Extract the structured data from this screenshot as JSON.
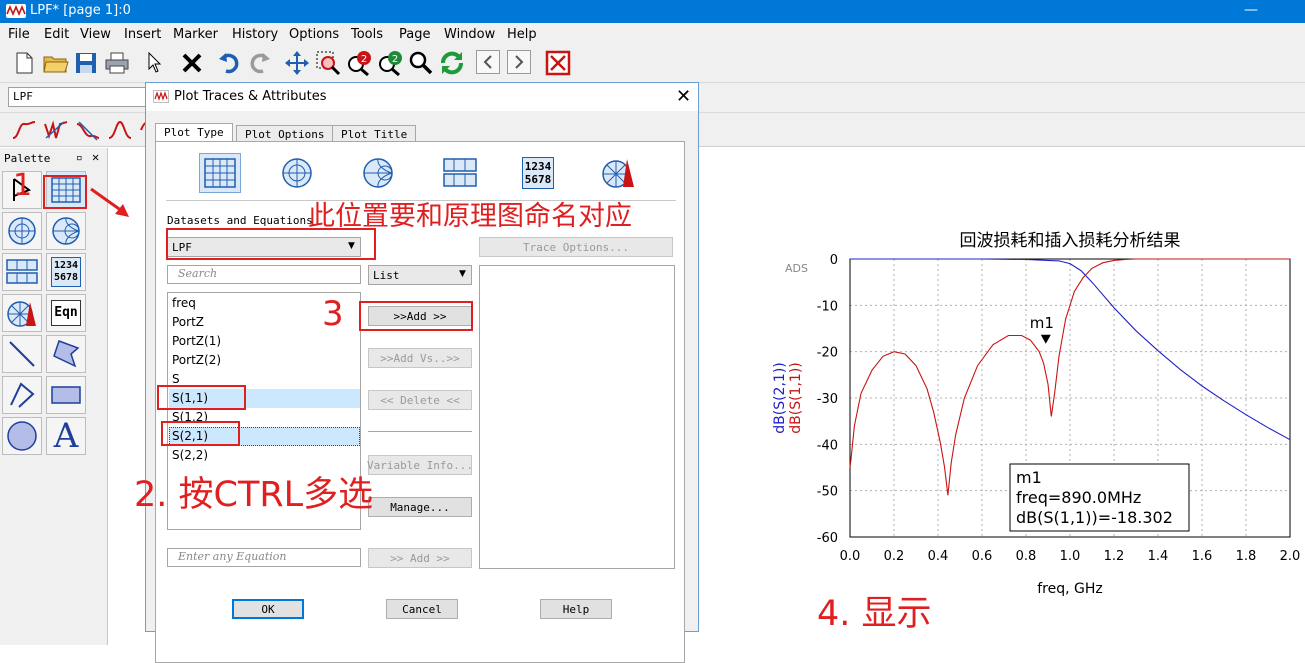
{
  "window": {
    "title": "LPF* [page 1]:0"
  },
  "menu": [
    "File",
    "Edit",
    "View",
    "Insert",
    "Marker",
    "History",
    "Options",
    "Tools",
    "Page",
    "Window",
    "Help"
  ],
  "toolbar": {
    "design_combo": "LPF"
  },
  "palette": {
    "title": "Palette",
    "eqn_label": "Eqn",
    "numbers_label_top": "1234",
    "numbers_label_bottom": "5678",
    "text_label": "A"
  },
  "dialog": {
    "title": "Plot Traces & Attributes",
    "tabs": [
      "Plot Type",
      "Plot Options",
      "Plot Title"
    ],
    "plot_icon_numbers_top": "1234",
    "plot_icon_numbers_bottom": "5678",
    "datasets_label": "Datasets and Equations",
    "dataset_value": "LPF",
    "search_placeholder": "Search",
    "list_mode": "List",
    "variables": [
      "freq",
      "PortZ",
      "PortZ(1)",
      "PortZ(2)",
      "S",
      "S(1,1)",
      "S(1,2)",
      "S(2,1)",
      "S(2,2)"
    ],
    "buttons": {
      "trace_options": "Trace Options...",
      "add": ">>Add >>",
      "add_vs": ">>Add Vs..>>",
      "delete": "<< Delete <<",
      "variable_info": "Variable Info...",
      "manage": "Manage...",
      "add_eq": ">> Add >>",
      "ok": "OK",
      "cancel": "Cancel",
      "help": "Help"
    },
    "equation_placeholder": "Enter any Equation"
  },
  "annotations": {
    "step1": "1",
    "dataset_note": "此位置要和原理图命名对应",
    "step3": "3",
    "step2": "2. 按CTRL多选",
    "step4": "4. 显示"
  },
  "chart_data": {
    "type": "line",
    "title": "回波损耗和插入损耗分析结果",
    "watermark": "ADS",
    "xlabel": "freq, GHz",
    "ylabel_series": [
      "dB(S(2,1))",
      "dB(S(1,1))"
    ],
    "xlim": [
      0.0,
      2.0
    ],
    "ylim": [
      -60,
      0
    ],
    "xticks": [
      "0.0",
      "0.2",
      "0.4",
      "0.6",
      "0.8",
      "1.0",
      "1.2",
      "1.4",
      "1.6",
      "1.8",
      "2.0"
    ],
    "yticks": [
      "0",
      "-10",
      "-20",
      "-30",
      "-40",
      "-50",
      "-60"
    ],
    "grid": true,
    "series": [
      {
        "name": "dB(S(2,1))",
        "color": "#2020c8",
        "x": [
          0.0,
          0.6,
          0.8,
          0.95,
          1.0,
          1.05,
          1.1,
          1.2,
          1.3,
          1.4,
          1.5,
          1.6,
          1.7,
          1.8,
          1.9,
          2.0
        ],
        "y": [
          0,
          0,
          -0.1,
          -0.4,
          -1.0,
          -2.5,
          -5.0,
          -10.5,
          -15.5,
          -19.8,
          -23.8,
          -27.4,
          -30.6,
          -33.6,
          -36.4,
          -39.0
        ]
      },
      {
        "name": "dB(S(1,1))",
        "color": "#c81414",
        "x": [
          0.0,
          0.005,
          0.02,
          0.05,
          0.1,
          0.15,
          0.2,
          0.25,
          0.3,
          0.35,
          0.38,
          0.41,
          0.43,
          0.445,
          0.46,
          0.48,
          0.52,
          0.58,
          0.65,
          0.72,
          0.78,
          0.82,
          0.86,
          0.88,
          0.9,
          0.915,
          0.93,
          0.95,
          0.98,
          1.02,
          1.06,
          1.1,
          1.15,
          1.2,
          1.25,
          1.3,
          1.4,
          1.6,
          2.0
        ],
        "y": [
          -45,
          -43,
          -36,
          -29,
          -24,
          -21,
          -20,
          -20.5,
          -23,
          -28,
          -33,
          -39.5,
          -45,
          -51,
          -44,
          -38,
          -30,
          -23,
          -18.5,
          -16.5,
          -16.5,
          -17.5,
          -20,
          -22.5,
          -27,
          -34,
          -29,
          -21,
          -13,
          -7,
          -4,
          -2,
          -0.8,
          -0.3,
          -0.1,
          0,
          0,
          0,
          0
        ]
      }
    ],
    "marker": {
      "label": "m1",
      "x": 0.89,
      "y": -18.302,
      "lines": [
        "m1",
        "freq=890.0MHz",
        "dB(S(1,1))=-18.302"
      ]
    }
  }
}
